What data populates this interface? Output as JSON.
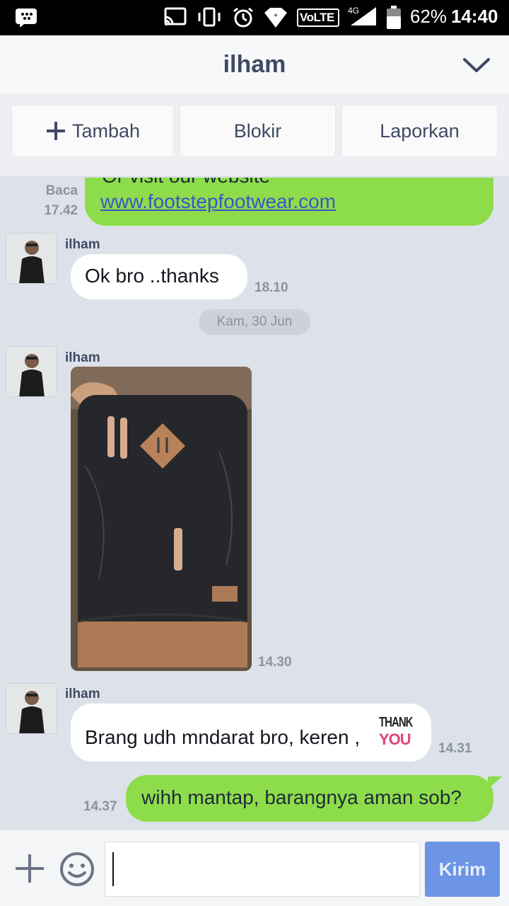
{
  "status_bar": {
    "battery": "62%",
    "time": "14:40",
    "network": "4G",
    "volte": "VoLTE"
  },
  "header": {
    "title": "ilham"
  },
  "actions": {
    "add": "Tambah",
    "block": "Blokir",
    "report": "Laporkan"
  },
  "messages": {
    "m0": {
      "text_partial": "Or visit our website",
      "link": "www.footstepfootwear.com",
      "status": "Baca",
      "time": "17.42"
    },
    "m1": {
      "sender": "ilham",
      "text": "Ok bro ..thanks",
      "time": "18.10"
    },
    "date_separator": "Kam, 30 Jun",
    "m2": {
      "sender": "ilham",
      "time": "14.30"
    },
    "m3": {
      "sender": "ilham",
      "text": "Brang udh mndarat bro, keren ,",
      "sticker_top": "THANK",
      "sticker_bottom": "YOU",
      "time": "14.31"
    },
    "m4": {
      "text": "wihh mantap, barangnya aman sob?",
      "time": "14.37"
    }
  },
  "input": {
    "value": "",
    "send_label": "Kirim"
  },
  "colors": {
    "my_bubble": "#8ddd4a",
    "their_bubble": "#ffffff",
    "chat_bg": "#dde2ea",
    "send_button": "#6d95e6",
    "header_text": "#3f4a64"
  }
}
